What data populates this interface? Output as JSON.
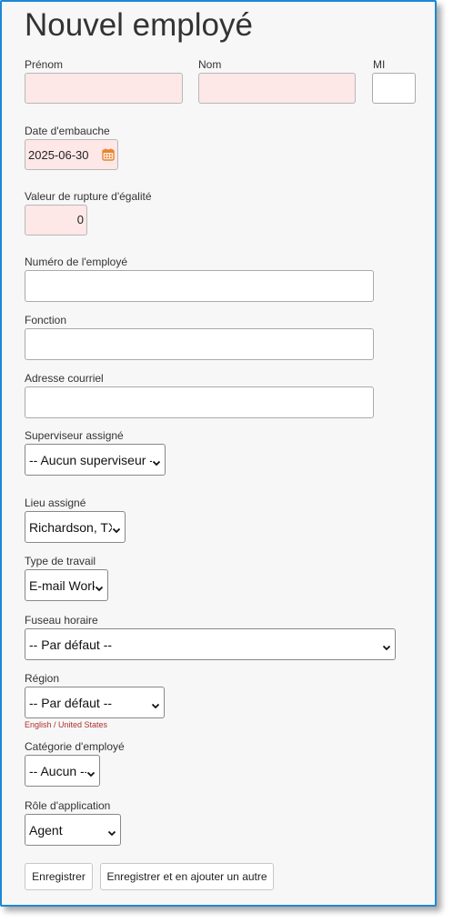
{
  "title": "Nouvel employé",
  "fields": {
    "first_name": {
      "label": "Prénom",
      "value": ""
    },
    "last_name": {
      "label": "Nom",
      "value": ""
    },
    "mi": {
      "label": "MI",
      "value": ""
    },
    "hire_date": {
      "label": "Date d'embauche",
      "value": "2025-06-30",
      "icon": "calendar-icon"
    },
    "tie_breaker": {
      "label": "Valeur de rupture d'égalité",
      "value": "0"
    },
    "employee_number": {
      "label": "Numéro de l'employé",
      "value": ""
    },
    "job_title": {
      "label": "Fonction",
      "value": ""
    },
    "email": {
      "label": "Adresse courriel",
      "value": ""
    },
    "supervisor": {
      "label": "Superviseur assigné",
      "selected": "-- Aucun superviseur --"
    },
    "location": {
      "label": "Lieu assigné",
      "selected": "Richardson, TX"
    },
    "work_type": {
      "label": "Type de travail",
      "selected": "E-mail Work"
    },
    "timezone": {
      "label": "Fuseau horaire",
      "selected": "-- Par défaut --"
    },
    "region": {
      "label": "Région",
      "selected": "-- Par défaut --",
      "hint": "English / United States"
    },
    "category": {
      "label": "Catégorie d'employé",
      "selected": "-- Aucun --"
    },
    "app_role": {
      "label": "Rôle d'application",
      "selected": "Agent"
    }
  },
  "buttons": {
    "save": "Enregistrer",
    "save_add": "Enregistrer et en ajouter un autre"
  },
  "colors": {
    "accent_border": "#1e88d6",
    "required_bg": "#fde7e7",
    "hint_text": "#b03030",
    "calendar_icon": "#e8862a"
  }
}
